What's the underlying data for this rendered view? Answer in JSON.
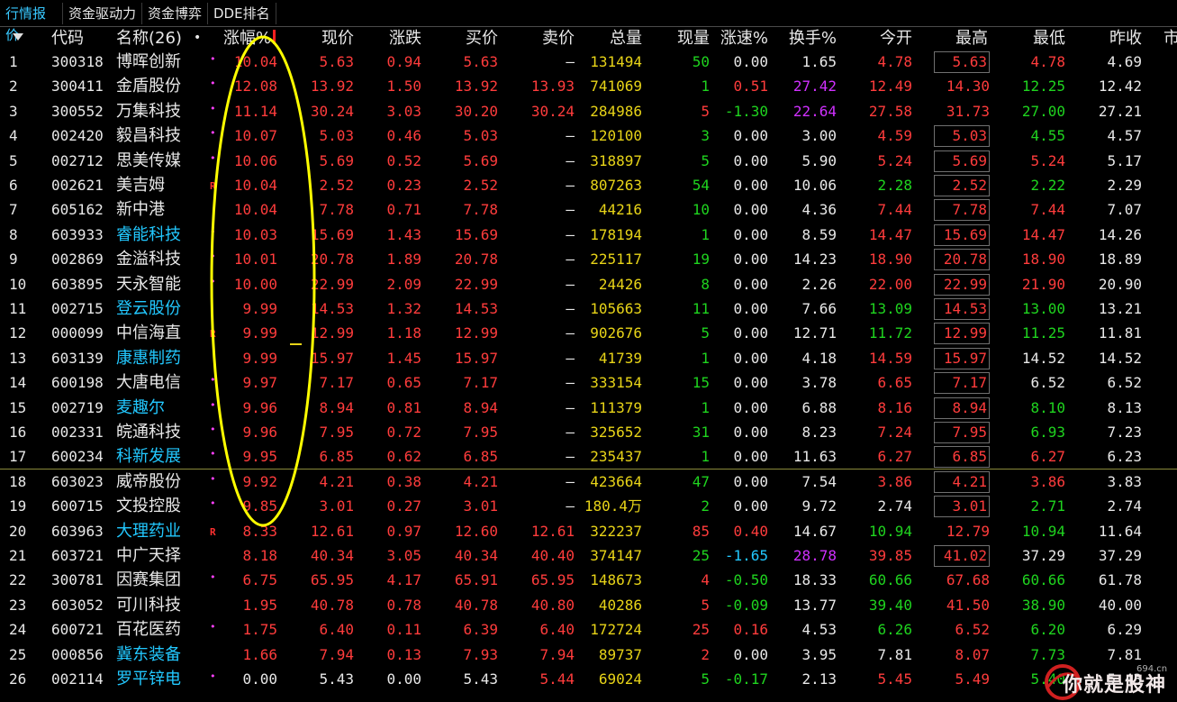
{
  "tabs": [
    {
      "label": "行情报价",
      "active": true
    },
    {
      "label": "资金驱动力",
      "active": false
    },
    {
      "label": "资金博弈",
      "active": false
    },
    {
      "label": "DDE排名",
      "active": false
    }
  ],
  "header": {
    "code": "代码",
    "name": "名称(26)",
    "dot": "•",
    "pct": "涨幅%",
    "price": "现价",
    "chg": "涨跌",
    "buy": "买价",
    "sell": "卖价",
    "vol": "总量",
    "cur": "现量",
    "spd": "涨速%",
    "turn": "换手%",
    "open": "今开",
    "high": "最高",
    "low": "最低",
    "prev": "昨收",
    "more": "市"
  },
  "colors": {
    "up": "#ff3c3c",
    "down": "#1fd41f",
    "flat": "#e8e8e8",
    "cyan": "#22c8ff",
    "vol": "#e8d418",
    "turnover_high": "#d030ff",
    "annotation": "#ffff00"
  },
  "rows": [
    {
      "idx": "1",
      "code": "300318",
      "name": "博晖创新",
      "name_color": "white",
      "mark": "•",
      "pct": "10.04",
      "price": "5.63",
      "chg": "0.94",
      "buy": "5.63",
      "sell": "—",
      "vol": "131494",
      "cur": "50",
      "cur_color": "green",
      "spd": "0.00",
      "spd_color": "white",
      "turn": "1.65",
      "turn_color": "white",
      "open": "4.78",
      "open_color": "red",
      "high": "5.63",
      "high_color": "red",
      "high_box": true,
      "low": "4.78",
      "low_color": "red",
      "prev": "4.69"
    },
    {
      "idx": "2",
      "code": "300411",
      "name": "金盾股份",
      "name_color": "white",
      "mark": "•",
      "pct": "12.08",
      "price": "13.92",
      "chg": "1.50",
      "buy": "13.92",
      "sell": "13.93",
      "vol": "741069",
      "cur": "1",
      "cur_color": "green",
      "spd": "0.51",
      "spd_color": "red",
      "turn": "27.42",
      "turn_color": "magenta",
      "open": "12.49",
      "open_color": "red",
      "high": "14.30",
      "high_color": "red",
      "high_box": false,
      "low": "12.25",
      "low_color": "green",
      "prev": "12.42"
    },
    {
      "idx": "3",
      "code": "300552",
      "name": "万集科技",
      "name_color": "white",
      "mark": "•",
      "pct": "11.14",
      "price": "30.24",
      "chg": "3.03",
      "buy": "30.20",
      "sell": "30.24",
      "vol": "284986",
      "cur": "5",
      "cur_color": "red",
      "spd": "-1.30",
      "spd_color": "green",
      "turn": "22.64",
      "turn_color": "magenta",
      "open": "27.58",
      "open_color": "red",
      "high": "31.73",
      "high_color": "red",
      "high_box": false,
      "low": "27.00",
      "low_color": "green",
      "prev": "27.21"
    },
    {
      "idx": "4",
      "code": "002420",
      "name": "毅昌科技",
      "name_color": "white",
      "mark": "•",
      "pct": "10.07",
      "price": "5.03",
      "chg": "0.46",
      "buy": "5.03",
      "sell": "—",
      "vol": "120100",
      "cur": "3",
      "cur_color": "green",
      "spd": "0.00",
      "spd_color": "white",
      "turn": "3.00",
      "turn_color": "white",
      "open": "4.59",
      "open_color": "red",
      "high": "5.03",
      "high_color": "red",
      "high_box": true,
      "low": "4.55",
      "low_color": "green",
      "prev": "4.57"
    },
    {
      "idx": "5",
      "code": "002712",
      "name": "思美传媒",
      "name_color": "white",
      "mark": "•",
      "pct": "10.06",
      "price": "5.69",
      "chg": "0.52",
      "buy": "5.69",
      "sell": "—",
      "vol": "318897",
      "cur": "5",
      "cur_color": "green",
      "spd": "0.00",
      "spd_color": "white",
      "turn": "5.90",
      "turn_color": "white",
      "open": "5.24",
      "open_color": "red",
      "high": "5.69",
      "high_color": "red",
      "high_box": true,
      "low": "5.24",
      "low_color": "red",
      "prev": "5.17"
    },
    {
      "idx": "6",
      "code": "002621",
      "name": "美吉姆",
      "name_color": "white",
      "mark": "R",
      "pct": "10.04",
      "price": "2.52",
      "chg": "0.23",
      "buy": "2.52",
      "sell": "—",
      "vol": "807263",
      "cur": "54",
      "cur_color": "green",
      "spd": "0.00",
      "spd_color": "white",
      "turn": "10.06",
      "turn_color": "white",
      "open": "2.28",
      "open_color": "green",
      "high": "2.52",
      "high_color": "red",
      "high_box": true,
      "low": "2.22",
      "low_color": "green",
      "prev": "2.29"
    },
    {
      "idx": "7",
      "code": "605162",
      "name": "新中港",
      "name_color": "white",
      "mark": "",
      "pct": "10.04",
      "price": "7.78",
      "chg": "0.71",
      "buy": "7.78",
      "sell": "—",
      "vol": "44216",
      "cur": "10",
      "cur_color": "green",
      "spd": "0.00",
      "spd_color": "white",
      "turn": "4.36",
      "turn_color": "white",
      "open": "7.44",
      "open_color": "red",
      "high": "7.78",
      "high_color": "red",
      "high_box": true,
      "low": "7.44",
      "low_color": "red",
      "prev": "7.07"
    },
    {
      "idx": "8",
      "code": "603933",
      "name": "睿能科技",
      "name_color": "cyan",
      "mark": "•",
      "pct": "10.03",
      "price": "15.69",
      "chg": "1.43",
      "buy": "15.69",
      "sell": "—",
      "vol": "178194",
      "cur": "1",
      "cur_color": "green",
      "spd": "0.00",
      "spd_color": "white",
      "turn": "8.59",
      "turn_color": "white",
      "open": "14.47",
      "open_color": "red",
      "high": "15.69",
      "high_color": "red",
      "high_box": true,
      "low": "14.47",
      "low_color": "red",
      "prev": "14.26"
    },
    {
      "idx": "9",
      "code": "002869",
      "name": "金溢科技",
      "name_color": "white",
      "mark": "•",
      "pct": "10.01",
      "price": "20.78",
      "chg": "1.89",
      "buy": "20.78",
      "sell": "—",
      "vol": "225117",
      "cur": "19",
      "cur_color": "green",
      "spd": "0.00",
      "spd_color": "white",
      "turn": "14.23",
      "turn_color": "white",
      "open": "18.90",
      "open_color": "red",
      "high": "20.78",
      "high_color": "red",
      "high_box": true,
      "low": "18.90",
      "low_color": "red",
      "prev": "18.89"
    },
    {
      "idx": "10",
      "code": "603895",
      "name": "天永智能",
      "name_color": "white",
      "mark": "•",
      "pct": "10.00",
      "price": "22.99",
      "chg": "2.09",
      "buy": "22.99",
      "sell": "—",
      "vol": "24426",
      "cur": "8",
      "cur_color": "green",
      "spd": "0.00",
      "spd_color": "white",
      "turn": "2.26",
      "turn_color": "white",
      "open": "22.00",
      "open_color": "red",
      "high": "22.99",
      "high_color": "red",
      "high_box": true,
      "low": "21.90",
      "low_color": "red",
      "prev": "20.90"
    },
    {
      "idx": "11",
      "code": "002715",
      "name": "登云股份",
      "name_color": "cyan",
      "mark": "",
      "pct": "9.99",
      "price": "14.53",
      "chg": "1.32",
      "buy": "14.53",
      "sell": "—",
      "vol": "105663",
      "cur": "11",
      "cur_color": "green",
      "spd": "0.00",
      "spd_color": "white",
      "turn": "7.66",
      "turn_color": "white",
      "open": "13.09",
      "open_color": "green",
      "high": "14.53",
      "high_color": "red",
      "high_box": true,
      "low": "13.00",
      "low_color": "green",
      "prev": "13.21"
    },
    {
      "idx": "12",
      "code": "000099",
      "name": "中信海直",
      "name_color": "white",
      "mark": "R",
      "pct": "9.99",
      "price": "12.99",
      "chg": "1.18",
      "buy": "12.99",
      "sell": "—",
      "vol": "902676",
      "cur": "5",
      "cur_color": "green",
      "spd": "0.00",
      "spd_color": "white",
      "turn": "12.71",
      "turn_color": "white",
      "open": "11.72",
      "open_color": "green",
      "high": "12.99",
      "high_color": "red",
      "high_box": true,
      "low": "11.25",
      "low_color": "green",
      "prev": "11.81"
    },
    {
      "idx": "13",
      "code": "603139",
      "name": "康惠制药",
      "name_color": "cyan",
      "mark": "",
      "pct": "9.99",
      "price": "15.97",
      "chg": "1.45",
      "buy": "15.97",
      "sell": "—",
      "vol": "41739",
      "cur": "1",
      "cur_color": "green",
      "spd": "0.00",
      "spd_color": "white",
      "turn": "4.18",
      "turn_color": "white",
      "open": "14.59",
      "open_color": "red",
      "high": "15.97",
      "high_color": "red",
      "high_box": true,
      "low": "14.52",
      "low_color": "white",
      "prev": "14.52"
    },
    {
      "idx": "14",
      "code": "600198",
      "name": "大唐电信",
      "name_color": "white",
      "mark": "•",
      "pct": "9.97",
      "price": "7.17",
      "chg": "0.65",
      "buy": "7.17",
      "sell": "—",
      "vol": "333154",
      "cur": "15",
      "cur_color": "green",
      "spd": "0.00",
      "spd_color": "white",
      "turn": "3.78",
      "turn_color": "white",
      "open": "6.65",
      "open_color": "red",
      "high": "7.17",
      "high_color": "red",
      "high_box": true,
      "low": "6.52",
      "low_color": "white",
      "prev": "6.52"
    },
    {
      "idx": "15",
      "code": "002719",
      "name": "麦趣尔",
      "name_color": "cyan",
      "mark": "•",
      "pct": "9.96",
      "price": "8.94",
      "chg": "0.81",
      "buy": "8.94",
      "sell": "—",
      "vol": "111379",
      "cur": "1",
      "cur_color": "green",
      "spd": "0.00",
      "spd_color": "white",
      "turn": "6.88",
      "turn_color": "white",
      "open": "8.16",
      "open_color": "red",
      "high": "8.94",
      "high_color": "red",
      "high_box": true,
      "low": "8.10",
      "low_color": "green",
      "prev": "8.13"
    },
    {
      "idx": "16",
      "code": "002331",
      "name": "皖通科技",
      "name_color": "white",
      "mark": "•",
      "pct": "9.96",
      "price": "7.95",
      "chg": "0.72",
      "buy": "7.95",
      "sell": "—",
      "vol": "325652",
      "cur": "31",
      "cur_color": "green",
      "spd": "0.00",
      "spd_color": "white",
      "turn": "8.23",
      "turn_color": "white",
      "open": "7.24",
      "open_color": "red",
      "high": "7.95",
      "high_color": "red",
      "high_box": true,
      "low": "6.93",
      "low_color": "green",
      "prev": "7.23"
    },
    {
      "idx": "17",
      "code": "600234",
      "name": "科新发展",
      "name_color": "cyan",
      "mark": "•",
      "pct": "9.95",
      "price": "6.85",
      "chg": "0.62",
      "buy": "6.85",
      "sell": "—",
      "vol": "235437",
      "cur": "1",
      "cur_color": "green",
      "spd": "0.00",
      "spd_color": "white",
      "turn": "11.63",
      "turn_color": "white",
      "open": "6.27",
      "open_color": "red",
      "high": "6.85",
      "high_color": "red",
      "high_box": true,
      "low": "6.27",
      "low_color": "red",
      "prev": "6.23"
    },
    {
      "idx": "18",
      "code": "603023",
      "name": "威帝股份",
      "name_color": "white",
      "mark": "•",
      "pct": "9.92",
      "price": "4.21",
      "chg": "0.38",
      "buy": "4.21",
      "sell": "—",
      "vol": "423664",
      "cur": "47",
      "cur_color": "green",
      "spd": "0.00",
      "spd_color": "white",
      "turn": "7.54",
      "turn_color": "white",
      "open": "3.86",
      "open_color": "red",
      "high": "4.21",
      "high_color": "red",
      "high_box": true,
      "low": "3.86",
      "low_color": "red",
      "prev": "3.83"
    },
    {
      "idx": "19",
      "code": "600715",
      "name": "文投控股",
      "name_color": "white",
      "mark": "•",
      "pct": "9.85",
      "price": "3.01",
      "chg": "0.27",
      "buy": "3.01",
      "sell": "—",
      "vol": "180.4万",
      "cur": "2",
      "cur_color": "green",
      "spd": "0.00",
      "spd_color": "white",
      "turn": "9.72",
      "turn_color": "white",
      "open": "2.74",
      "open_color": "white",
      "high": "3.01",
      "high_color": "red",
      "high_box": true,
      "low": "2.71",
      "low_color": "green",
      "prev": "2.74"
    },
    {
      "idx": "20",
      "code": "603963",
      "name": "大理药业",
      "name_color": "cyan",
      "mark": "R",
      "pct": "8.33",
      "price": "12.61",
      "chg": "0.97",
      "buy": "12.60",
      "sell": "12.61",
      "vol": "322237",
      "cur": "85",
      "cur_color": "red",
      "spd": "0.40",
      "spd_color": "red",
      "turn": "14.67",
      "turn_color": "white",
      "open": "10.94",
      "open_color": "green",
      "high": "12.79",
      "high_color": "red",
      "high_box": false,
      "low": "10.94",
      "low_color": "green",
      "prev": "11.64"
    },
    {
      "idx": "21",
      "code": "603721",
      "name": "中广天择",
      "name_color": "white",
      "mark": "",
      "pct": "8.18",
      "price": "40.34",
      "chg": "3.05",
      "buy": "40.34",
      "sell": "40.40",
      "vol": "374147",
      "cur": "25",
      "cur_color": "green",
      "spd": "-1.65",
      "spd_color": "cyan",
      "turn": "28.78",
      "turn_color": "magenta",
      "open": "39.85",
      "open_color": "red",
      "high": "41.02",
      "high_color": "red",
      "high_box": true,
      "low": "37.29",
      "low_color": "white",
      "prev": "37.29"
    },
    {
      "idx": "22",
      "code": "300781",
      "name": "因赛集团",
      "name_color": "white",
      "mark": "•",
      "pct": "6.75",
      "price": "65.95",
      "chg": "4.17",
      "buy": "65.91",
      "sell": "65.95",
      "vol": "148673",
      "cur": "4",
      "cur_color": "red",
      "spd": "-0.50",
      "spd_color": "green",
      "turn": "18.33",
      "turn_color": "white",
      "open": "60.66",
      "open_color": "green",
      "high": "67.68",
      "high_color": "red",
      "high_box": false,
      "low": "60.66",
      "low_color": "green",
      "prev": "61.78"
    },
    {
      "idx": "23",
      "code": "603052",
      "name": "可川科技",
      "name_color": "white",
      "mark": "",
      "pct": "1.95",
      "price": "40.78",
      "chg": "0.78",
      "buy": "40.78",
      "sell": "40.80",
      "vol": "40286",
      "cur": "5",
      "cur_color": "red",
      "spd": "-0.09",
      "spd_color": "green",
      "turn": "13.77",
      "turn_color": "white",
      "open": "39.40",
      "open_color": "green",
      "high": "41.50",
      "high_color": "red",
      "high_box": false,
      "low": "38.90",
      "low_color": "green",
      "prev": "40.00"
    },
    {
      "idx": "24",
      "code": "600721",
      "name": "百花医药",
      "name_color": "white",
      "mark": "•",
      "pct": "1.75",
      "price": "6.40",
      "chg": "0.11",
      "buy": "6.39",
      "sell": "6.40",
      "vol": "172724",
      "cur": "25",
      "cur_color": "red",
      "spd": "0.16",
      "spd_color": "red",
      "turn": "4.53",
      "turn_color": "white",
      "open": "6.26",
      "open_color": "green",
      "high": "6.52",
      "high_color": "red",
      "high_box": false,
      "low": "6.20",
      "low_color": "green",
      "prev": "6.29"
    },
    {
      "idx": "25",
      "code": "000856",
      "name": "冀东装备",
      "name_color": "cyan",
      "mark": "",
      "pct": "1.66",
      "price": "7.94",
      "chg": "0.13",
      "buy": "7.93",
      "sell": "7.94",
      "vol": "89737",
      "cur": "2",
      "cur_color": "red",
      "spd": "0.00",
      "spd_color": "white",
      "turn": "3.95",
      "turn_color": "white",
      "open": "7.81",
      "open_color": "white",
      "high": "8.07",
      "high_color": "red",
      "high_box": false,
      "low": "7.73",
      "low_color": "green",
      "prev": "7.81"
    },
    {
      "idx": "26",
      "code": "002114",
      "name": "罗平锌电",
      "name_color": "cyan",
      "mark": "•",
      "pct": "0.00",
      "pct_color": "white",
      "price": "5.43",
      "price_color": "white",
      "chg": "0.00",
      "chg_color": "white",
      "buy": "5.43",
      "buy_color": "white",
      "sell": "5.44",
      "vol": "69024",
      "cur": "5",
      "cur_color": "green",
      "spd": "-0.17",
      "spd_color": "green",
      "turn": "2.13",
      "turn_color": "white",
      "open": "5.45",
      "open_color": "red",
      "high": "5.49",
      "high_color": "red",
      "high_box": false,
      "low": "5.40",
      "low_color": "green",
      "prev": "5.43"
    }
  ],
  "watermark": {
    "text": "你就是股神",
    "site": "694.cn"
  }
}
